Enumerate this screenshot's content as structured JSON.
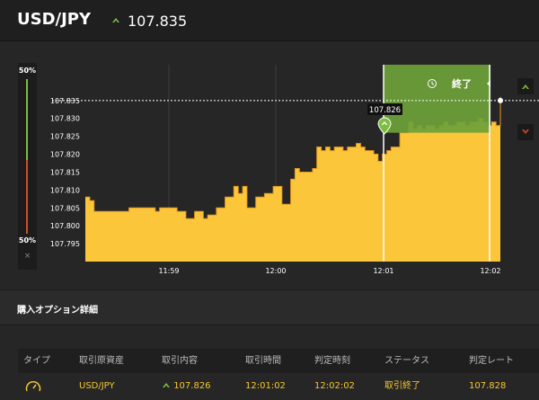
{
  "header": {
    "pair": "USD/JPY",
    "price": "107.835",
    "direction_icon": "up-arrow-icon"
  },
  "gauge": {
    "top_label": "50%",
    "bottom_label": "50%",
    "close_label": "×",
    "up_color": "#7dbe3f",
    "down_color": "#d34b2a"
  },
  "chart_data": {
    "type": "area",
    "ylim": [
      107.79,
      107.845
    ],
    "y_ticks": [
      "107.835",
      "107.830",
      "107.825",
      "107.820",
      "107.815",
      "107.810",
      "107.805",
      "107.800",
      "107.795"
    ],
    "x_ticks": [
      "11:59",
      "12:00",
      "12:01",
      "12:02"
    ],
    "current_price_label": "107.835",
    "entry_price_label": "107.826",
    "end_label": "終了",
    "fill_color": "#fcc63b",
    "entry_band_color": "#6ea13a",
    "series_values": [
      107.808,
      107.807,
      107.804,
      107.804,
      107.804,
      107.804,
      107.804,
      107.804,
      107.804,
      107.804,
      107.805,
      107.805,
      107.805,
      107.805,
      107.805,
      107.805,
      107.804,
      107.805,
      107.805,
      107.805,
      107.805,
      107.804,
      107.804,
      107.802,
      107.802,
      107.804,
      107.804,
      107.802,
      107.803,
      107.803,
      107.805,
      107.805,
      107.808,
      107.808,
      107.811,
      107.809,
      107.811,
      107.805,
      107.805,
      107.808,
      107.808,
      107.809,
      107.809,
      107.811,
      107.811,
      107.806,
      107.806,
      107.813,
      107.816,
      107.815,
      107.815,
      107.815,
      107.816,
      107.822,
      107.821,
      107.822,
      107.821,
      107.822,
      107.822,
      107.821,
      107.822,
      107.822,
      107.823,
      107.822,
      107.821,
      107.821,
      107.82,
      107.818,
      107.82,
      107.821,
      107.822,
      107.822,
      107.826,
      107.826,
      107.829,
      107.827,
      107.828,
      107.827,
      107.828,
      107.828,
      107.827,
      107.828,
      107.829,
      107.828,
      107.828,
      107.829,
      107.829,
      107.828,
      107.829,
      107.829,
      107.83,
      107.829,
      107.828,
      107.829,
      107.828,
      107.836
    ]
  },
  "section_title": "購入オプション詳細",
  "table": {
    "headers": [
      "タイプ",
      "取引原資産",
      "取引内容",
      "取引時間",
      "判定時刻",
      "ステータス",
      "判定レート"
    ],
    "row": {
      "type_icon": "timer-gauge-icon",
      "asset": "USD/JPY",
      "direction_icon": "up-arrow-icon",
      "content": "107.826",
      "trade_time": "12:01:02",
      "judge_time": "12:02:02",
      "status": "取引終了",
      "judge_rate": "107.828"
    }
  }
}
